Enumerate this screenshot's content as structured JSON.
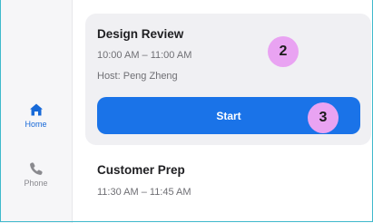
{
  "sidebar": {
    "items": [
      {
        "label": "Home",
        "icon": "home-icon",
        "active": true
      },
      {
        "label": "Phone",
        "icon": "phone-icon",
        "active": false
      }
    ]
  },
  "meetings": [
    {
      "title": "Design Review",
      "time": "10:00 AM – 11:00 AM",
      "host": "Host: Peng Zheng",
      "action_label": "Start"
    },
    {
      "title": "Customer Prep",
      "time": "11:30 AM – 11:45 AM"
    }
  ],
  "badges": [
    "2",
    "3"
  ],
  "colors": {
    "accent": "#1a73e8",
    "badge": "#e9a3f2",
    "card_bg": "#f0f0f3",
    "sidebar_bg": "#f6f6f8"
  }
}
